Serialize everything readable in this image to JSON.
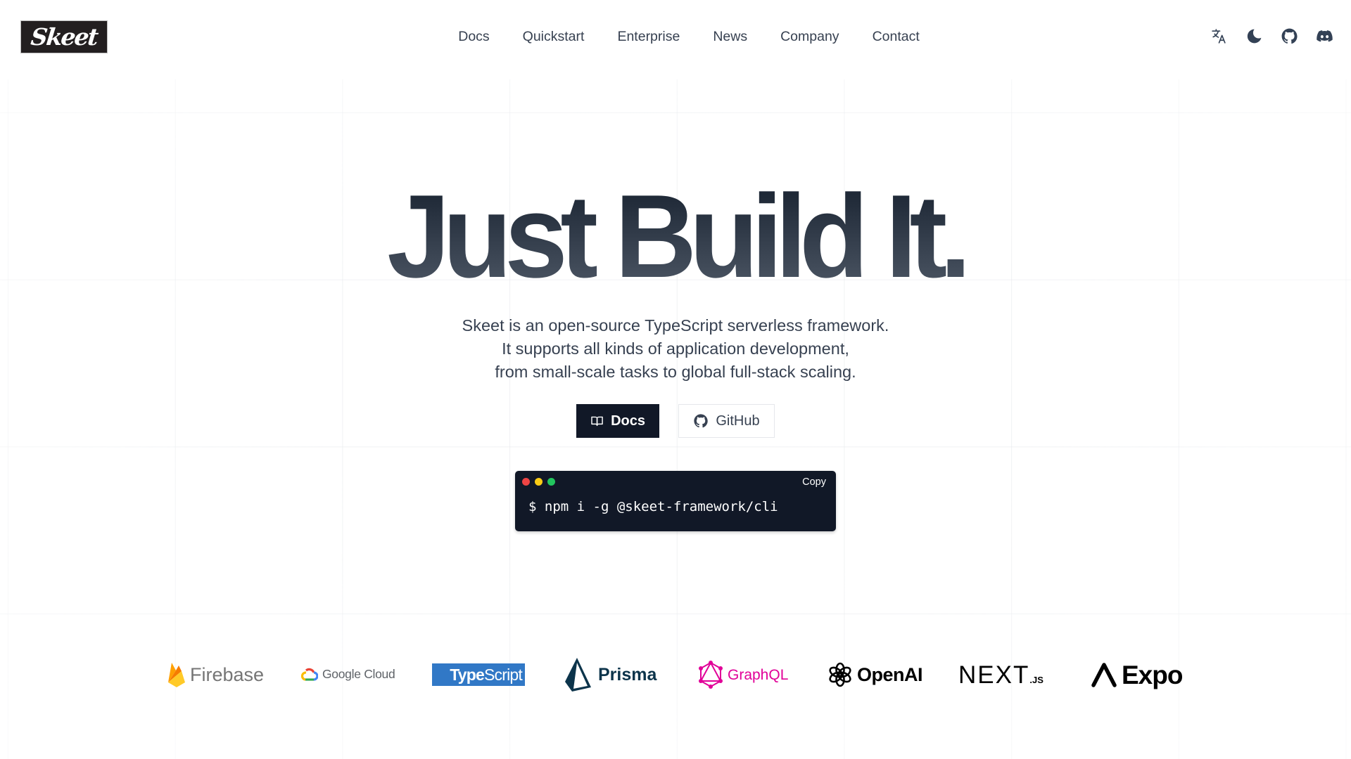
{
  "brand": {
    "name": "Skeet"
  },
  "nav": {
    "items": [
      {
        "label": "Docs"
      },
      {
        "label": "Quickstart"
      },
      {
        "label": "Enterprise"
      },
      {
        "label": "News"
      },
      {
        "label": "Company"
      },
      {
        "label": "Contact"
      }
    ]
  },
  "header_icons": [
    {
      "icon": "translate-icon",
      "label": "Language"
    },
    {
      "icon": "moon-icon",
      "label": "Dark mode"
    },
    {
      "icon": "github-icon",
      "label": "GitHub"
    },
    {
      "icon": "discord-icon",
      "label": "Discord"
    }
  ],
  "hero": {
    "title": "Just Build It.",
    "description": [
      "Skeet is an open-source TypeScript serverless framework.",
      "It supports all kinds of application development,",
      "from small-scale tasks to global full-stack scaling."
    ],
    "primary_button": {
      "label": "Docs",
      "icon": "book-open-icon"
    },
    "secondary_button": {
      "label": "GitHub",
      "icon": "github-icon"
    }
  },
  "terminal": {
    "copy_label": "Copy",
    "command": "$ npm i -g @skeet-framework/cli",
    "dots": [
      "#ef4444",
      "#facc15",
      "#22c55e"
    ]
  },
  "logos": [
    {
      "name": "Firebase"
    },
    {
      "name": "Google Cloud"
    },
    {
      "name_bold": "Type",
      "name_rest": "Script"
    },
    {
      "name": "Prisma"
    },
    {
      "name": "GraphQL"
    },
    {
      "name": "OpenAI"
    },
    {
      "name": "NEXT",
      "suffix": ".JS"
    },
    {
      "name": "Expo"
    }
  ],
  "colors": {
    "primary_button_bg": "#111827",
    "terminal_bg": "#111827",
    "text": "#374151",
    "typescript_blue": "#3178c6",
    "graphql_pink": "#e10098",
    "prisma_navy": "#0c344b"
  }
}
